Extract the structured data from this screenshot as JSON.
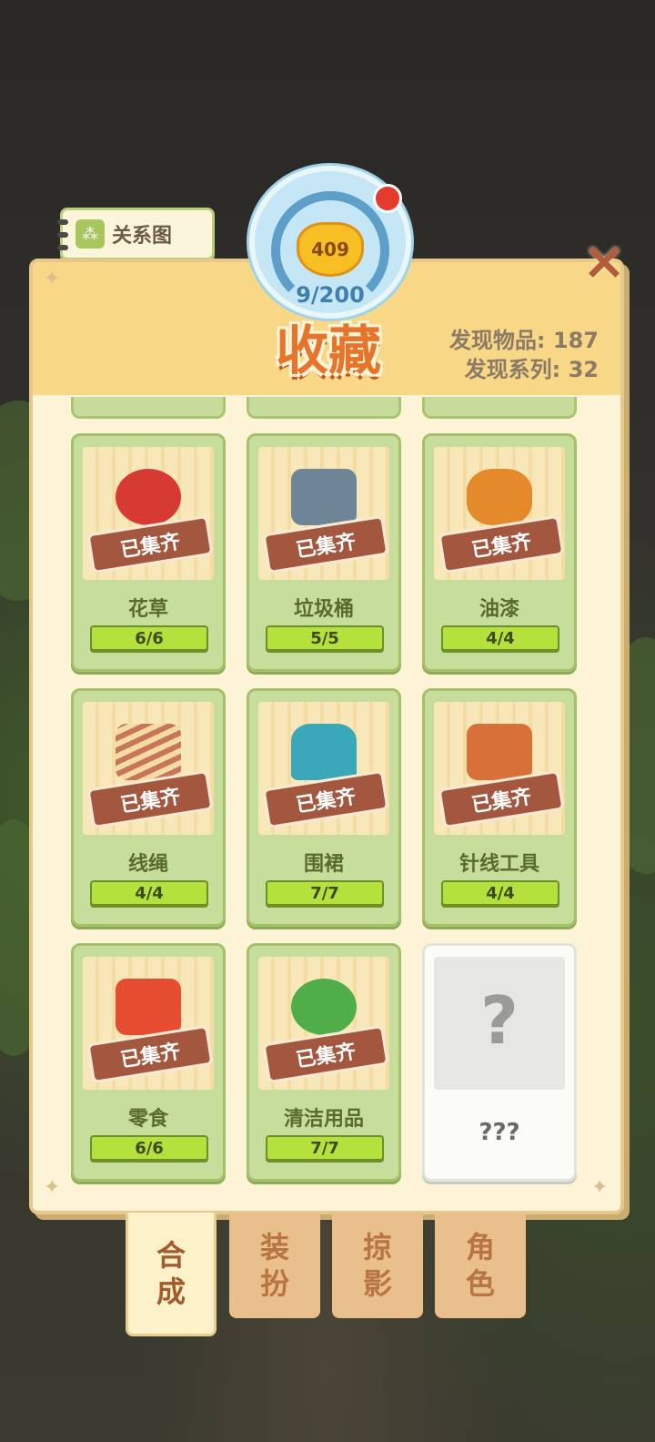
{
  "header": {
    "title": "收藏",
    "badge_progress": "9/200",
    "heart_count": "409",
    "stats": [
      {
        "label": "发现物品:",
        "value": "187"
      },
      {
        "label": "发现系列:",
        "value": "32"
      }
    ]
  },
  "relation_tab": {
    "label": "关系图"
  },
  "close_icon": "×",
  "cards": [
    {
      "name": "花草",
      "progress": "6/6",
      "stamp": "已集齐",
      "art": "flowers",
      "color": "#d63a33"
    },
    {
      "name": "垃圾桶",
      "progress": "5/5",
      "stamp": "已集齐",
      "art": "trash-bin",
      "color": "#6d8596"
    },
    {
      "name": "油漆",
      "progress": "4/4",
      "stamp": "已集齐",
      "art": "paint-cans",
      "color": "#e58a2b"
    },
    {
      "name": "线绳",
      "progress": "4/4",
      "stamp": "已集齐",
      "art": "rope",
      "color": "#c8765a"
    },
    {
      "name": "围裙",
      "progress": "7/7",
      "stamp": "已集齐",
      "art": "apron",
      "color": "#3aa8b8"
    },
    {
      "name": "针线工具",
      "progress": "4/4",
      "stamp": "已集齐",
      "art": "sewing-box",
      "color": "#d8703a"
    },
    {
      "name": "零食",
      "progress": "6/6",
      "stamp": "已集齐",
      "art": "snacks",
      "color": "#e64c30"
    },
    {
      "name": "清洁用品",
      "progress": "7/7",
      "stamp": "已集齐",
      "art": "cleaning-supplies",
      "color": "#4fae4a"
    }
  ],
  "locked_card": {
    "name": "???",
    "icon": "?"
  },
  "tabs": [
    {
      "label_1": "合",
      "label_2": "成"
    },
    {
      "label_1": "装",
      "label_2": "扮"
    },
    {
      "label_1": "掠",
      "label_2": "影"
    },
    {
      "label_1": "角",
      "label_2": "色"
    }
  ]
}
